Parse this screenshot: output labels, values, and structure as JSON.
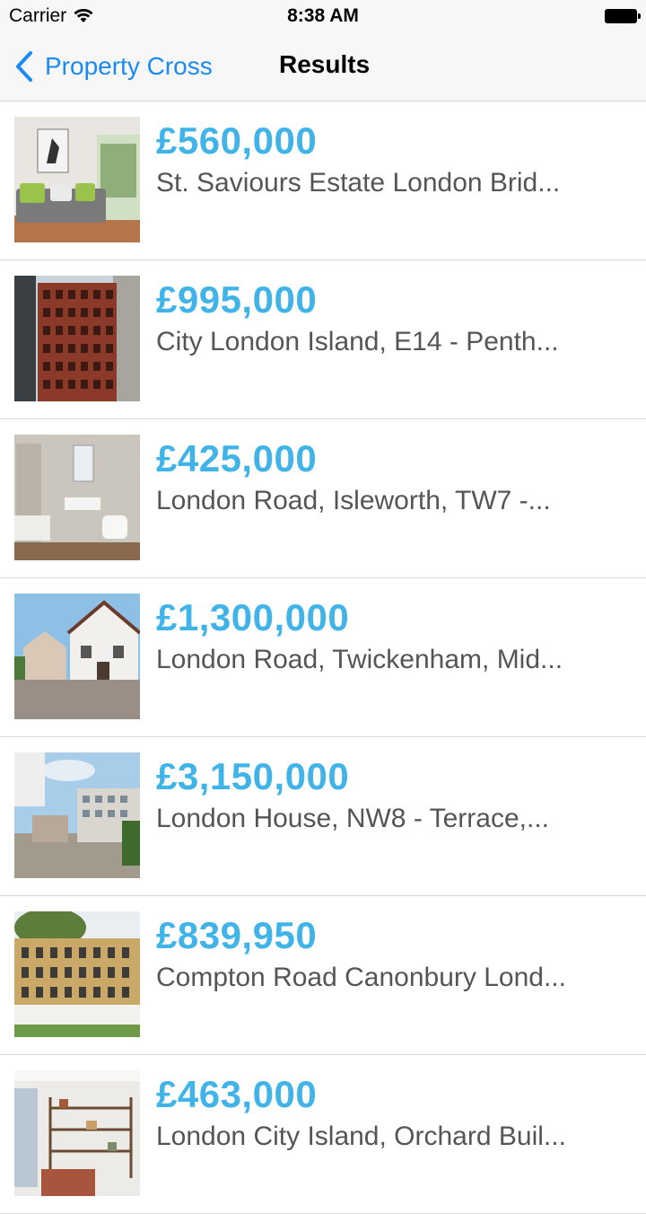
{
  "status_bar": {
    "carrier": "Carrier",
    "time": "8:38 AM"
  },
  "nav": {
    "back_label": "Property Cross",
    "title": "Results",
    "accent_color": "#1a8af5"
  },
  "listings": [
    {
      "price": "£560,000",
      "title": "St. Saviours Estate London Brid..."
    },
    {
      "price": "£995,000",
      "title": "City London Island, E14 - Penth..."
    },
    {
      "price": "£425,000",
      "title": "London Road, Isleworth, TW7 -..."
    },
    {
      "price": "£1,300,000",
      "title": "London Road, Twickenham, Mid..."
    },
    {
      "price": "£3,150,000",
      "title": "London House, NW8 - Terrace,..."
    },
    {
      "price": "£839,950",
      "title": "Compton Road Canonbury Lond..."
    },
    {
      "price": "£463,000",
      "title": "London City Island, Orchard Buil..."
    }
  ],
  "colors": {
    "price": "#40b4e8",
    "title": "#555555"
  }
}
